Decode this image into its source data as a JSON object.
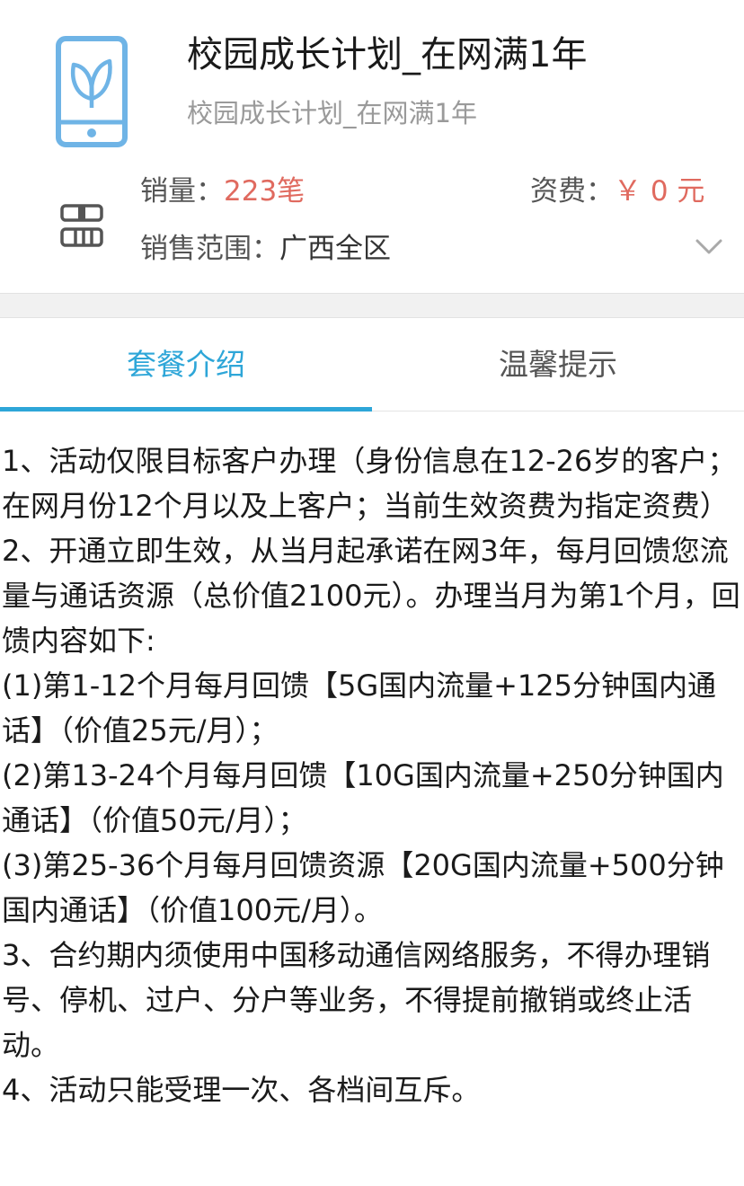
{
  "header": {
    "title": "校园成长计划_在网满1年",
    "subtitle": "校园成长计划_在网满1年",
    "product_icon": "phone-leaf-icon",
    "qr_icon": "qr-code-icon",
    "sales_label": "销量：",
    "sales_value": "223笔",
    "fee_label": "资费：",
    "fee_value": "￥ 0 元",
    "scope_label": "销售范围：",
    "scope_value": "广西全区",
    "expand_icon": "chevron-down-icon"
  },
  "colors": {
    "accent": "#2ea6d8",
    "price": "#e06a5f"
  },
  "tabs": [
    {
      "label": "套餐介绍",
      "active": true
    },
    {
      "label": "温馨提示",
      "active": false
    }
  ],
  "content": {
    "paragraphs": [
      "1、活动仅限目标客户办理（身份信息在12-26岁的客户；在网月份12个月以及上客户；当前生效资费为指定资费）",
      "2、开通立即生效，从当月起承诺在网3年，每月回馈您流量与通话资源（总价值2100元）。办理当月为第1个月，回馈内容如下:",
      "(1)第1-12个月每月回馈【5G国内流量+125分钟国内通话】（价值25元/月）；",
      "(2)第13-24个月每月回馈【10G国内流量+250分钟国内通话】（价值50元/月）；",
      "(3)第25-36个月每月回馈资源【20G国内流量+500分钟国内通话】（价值100元/月）。",
      "3、合约期内须使用中国移动通信网络服务，不得办理销号、停机、过户、分户等业务，不得提前撤销或终止活动。",
      "4、活动只能受理一次、各档间互斥。"
    ]
  }
}
